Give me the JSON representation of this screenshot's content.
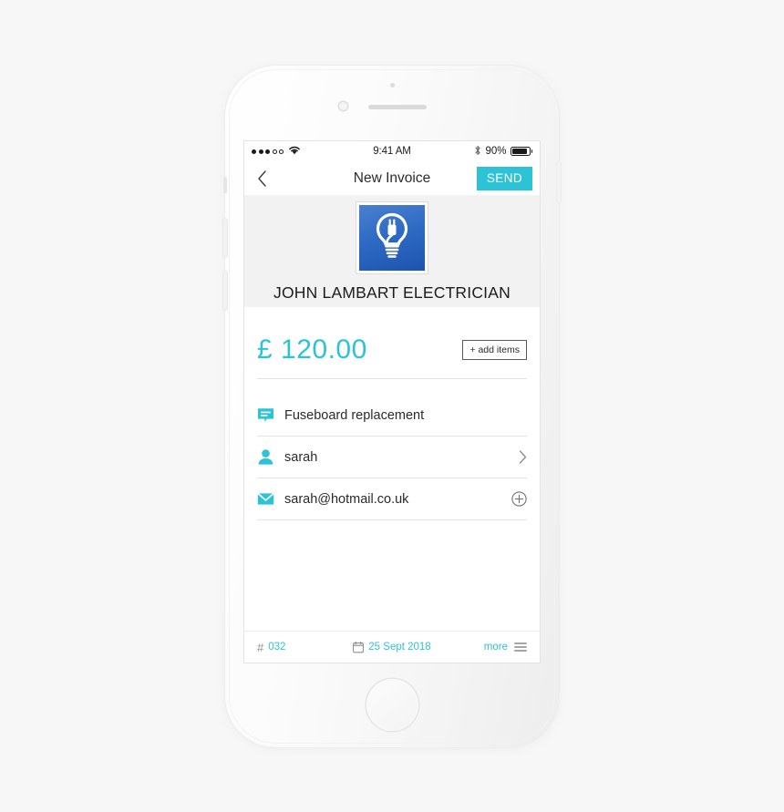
{
  "status_bar": {
    "signal_dots_filled": 3,
    "signal_dots_total": 5,
    "wifi_icon": "wifi-icon",
    "time": "9:41 AM",
    "bluetooth_icon": "bluetooth-icon",
    "battery_percent": "90%",
    "battery_level": 90
  },
  "nav": {
    "back_icon": "chevron-left-icon",
    "title": "New Invoice",
    "send_label": "SEND"
  },
  "header": {
    "logo_icon": "lightbulb-plug-icon",
    "company_name": "JOHN LAMBART ELECTRICIAN"
  },
  "invoice": {
    "amount": "£ 120.00",
    "add_items_label": "+ add items",
    "rows": [
      {
        "icon": "comment-icon",
        "text": "Fuseboard replacement",
        "trailing": "none"
      },
      {
        "icon": "person-icon",
        "text": "sarah",
        "trailing": "chevron-right-icon"
      },
      {
        "icon": "envelope-icon",
        "text": "sarah@hotmail.co.uk",
        "trailing": "plus-circle-icon"
      }
    ]
  },
  "footer": {
    "hash_symbol": "#",
    "invoice_number": "032",
    "calendar_icon": "calendar-icon",
    "date": "25 Sept 2018",
    "more_label": "more",
    "menu_icon": "hamburger-menu-icon"
  },
  "colors": {
    "accent": "#2dc3d6",
    "logo_blue": "#2f6bc4",
    "page_background": "#f7f7f7",
    "header_background": "#f2f2f2"
  }
}
